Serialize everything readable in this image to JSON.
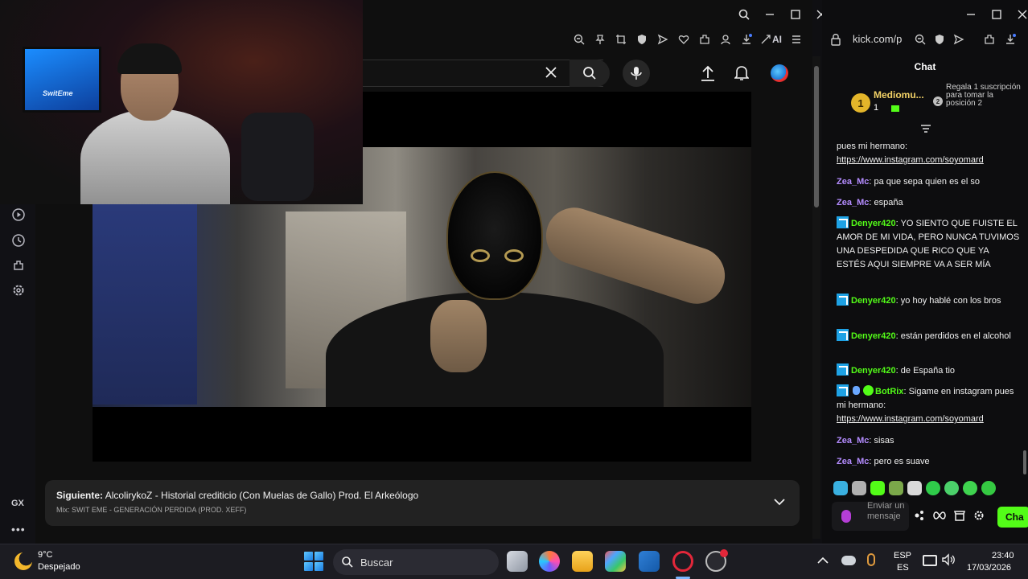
{
  "browser": {
    "sidebar_label": "GX",
    "more_label": "•••",
    "ai_label": "AI"
  },
  "youtube": {
    "upnext": {
      "prefix": "Siguiente:",
      "title": "AlcolirykoZ - Historial crediticio (Con Muelas de Gallo) Prod. El Arkeólogo",
      "mix": "Mix: SWIT EME - GENERACIÓN PERDIDA (PROD. XEFF)"
    }
  },
  "webcam": {
    "monitor_text": "SwitEme"
  },
  "kick": {
    "url": "kick.com/p",
    "chat_title": "Chat",
    "leader": {
      "rank": "1",
      "name": "Mediomu...",
      "count": "1",
      "second_rank": "2",
      "second_text": "Regala 1 suscripción para tomar la posición 2"
    },
    "messages": [
      {
        "user": "",
        "text": "pues mi hermano:",
        "link": "https://www.instagram.com/soyomard",
        "partial": true
      },
      {
        "user": "Zea_Mc",
        "text": "pa que sepa quien es el so",
        "color": "#b48cff"
      },
      {
        "user": "Zea_Mc",
        "text": "españa",
        "color": "#b48cff"
      },
      {
        "user": "Denyer420",
        "text": "YO SIENTO QUE FUISTE EL AMOR DE MI VIDA, PERO NUNCA TUVIMOS UNA DESPEDIDA QUE RICO QUE YA ESTÉS AQUI SIEMPRE VA A SER MÍA",
        "color": "#53fc18"
      },
      {
        "user": "Denyer420",
        "text": "yo hoy hablé con los bros",
        "color": "#53fc18"
      },
      {
        "user": "Denyer420",
        "text": "están perdidos en el alcohol",
        "color": "#53fc18"
      },
      {
        "user": "Denyer420",
        "text": "de España tio",
        "color": "#53fc18"
      },
      {
        "user": "BotRix",
        "text": "Sigame en instagram pues mi hermano:",
        "link": "https://www.instagram.com/soyomard",
        "color": "#53fc18"
      },
      {
        "user": "Zea_Mc",
        "text": "sisas",
        "color": "#b48cff"
      },
      {
        "user": "Zea_Mc",
        "text": "pero es suave",
        "color": "#b48cff"
      }
    ],
    "input_placeholder": "Enviar un mensaje",
    "send_label": "Cha"
  },
  "taskbar": {
    "weather_temp": "9°C",
    "weather_desc": "Despejado",
    "search_label": "Buscar",
    "lang_1": "ESP",
    "lang_2": "ES",
    "time": "23:40",
    "date": "17/03/2026"
  }
}
